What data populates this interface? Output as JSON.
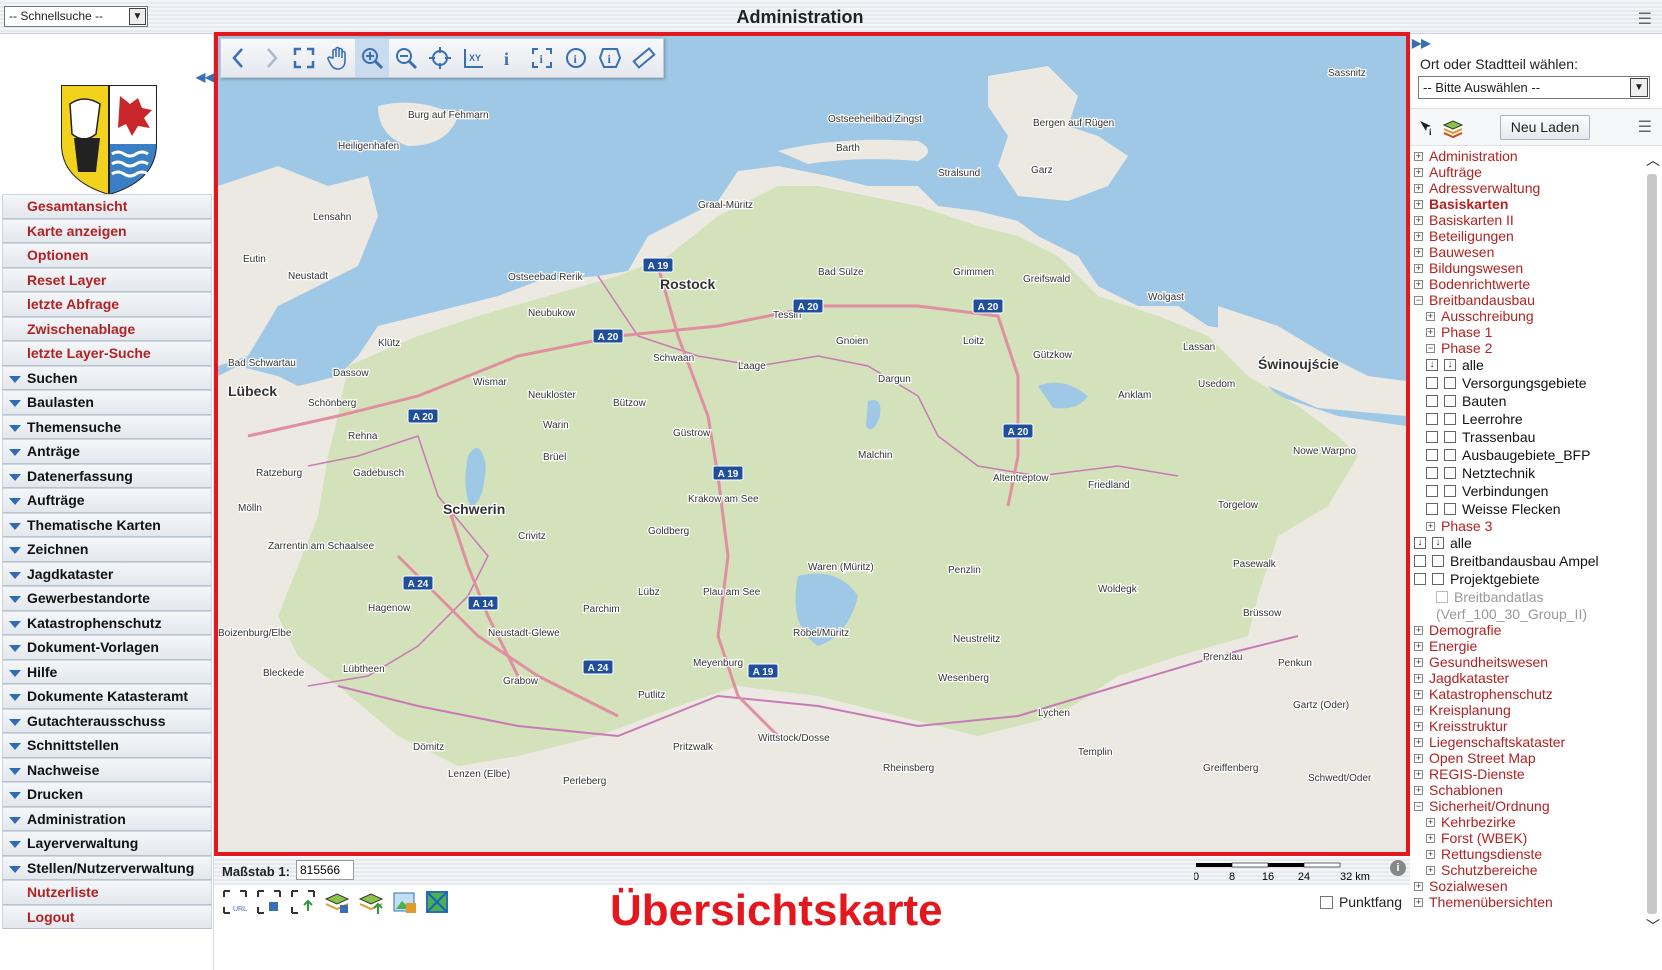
{
  "header": {
    "title": "Administration",
    "quicksearch": "-- Schnellsuche --",
    "menu_icon": "hamburger-icon"
  },
  "left_nav": {
    "items": [
      {
        "label": "Gesamtansicht",
        "style": "red"
      },
      {
        "label": "Karte anzeigen",
        "style": "red"
      },
      {
        "label": "Optionen",
        "style": "red"
      },
      {
        "label": "Reset Layer",
        "style": "red"
      },
      {
        "label": "letzte Abfrage",
        "style": "red"
      },
      {
        "label": "Zwischenablage",
        "style": "red"
      },
      {
        "label": "letzte Layer-Suche",
        "style": "red"
      },
      {
        "label": "Suchen",
        "style": "group"
      },
      {
        "label": "Baulasten",
        "style": "group"
      },
      {
        "label": "Themensuche",
        "style": "group"
      },
      {
        "label": "Anträge",
        "style": "group"
      },
      {
        "label": "Datenerfassung",
        "style": "group"
      },
      {
        "label": "Aufträge",
        "style": "group"
      },
      {
        "label": "Thematische Karten",
        "style": "group"
      },
      {
        "label": "Zeichnen",
        "style": "group"
      },
      {
        "label": "Jagdkataster",
        "style": "group"
      },
      {
        "label": "Gewerbestandorte",
        "style": "group"
      },
      {
        "label": "Katastrophenschutz",
        "style": "group"
      },
      {
        "label": "Dokument-Vorlagen",
        "style": "group"
      },
      {
        "label": "Hilfe",
        "style": "group"
      },
      {
        "label": "Dokumente Katasteramt",
        "style": "group"
      },
      {
        "label": "Gutachterausschuss",
        "style": "group"
      },
      {
        "label": "Schnittstellen",
        "style": "group"
      },
      {
        "label": "Nachweise",
        "style": "group"
      },
      {
        "label": "Drucken",
        "style": "group"
      },
      {
        "label": "Administration",
        "style": "group"
      },
      {
        "label": "Layerverwaltung",
        "style": "group"
      },
      {
        "label": "Stellen/Nutzerverwaltung",
        "style": "group"
      },
      {
        "label": "Nutzerliste",
        "style": "red"
      },
      {
        "label": "Logout",
        "style": "red"
      }
    ]
  },
  "map": {
    "places": [
      {
        "name": "Sassnitz"
      },
      {
        "name": "Burg auf Fehmarn"
      },
      {
        "name": "Ostseeheilbad Zingst"
      },
      {
        "name": "Bergen auf Rügen"
      },
      {
        "name": "Heiligenhafen"
      },
      {
        "name": "Barth"
      },
      {
        "name": "Garz"
      },
      {
        "name": "Stralsund"
      },
      {
        "name": "Graal-Müritz"
      },
      {
        "name": "Lensahn"
      },
      {
        "name": "Eutin"
      },
      {
        "name": "Neustadt"
      },
      {
        "name": "Ostseebad Rerik"
      },
      {
        "name": "Rostock"
      },
      {
        "name": "Bad Sülze"
      },
      {
        "name": "Grimmen"
      },
      {
        "name": "Greifswald"
      },
      {
        "name": "Wolgast"
      },
      {
        "name": "Neubukow"
      },
      {
        "name": "Tessin"
      },
      {
        "name": "Klütz"
      },
      {
        "name": "Gnoien"
      },
      {
        "name": "Loitz"
      },
      {
        "name": "Lassan"
      },
      {
        "name": "Świnoujście"
      },
      {
        "name": "Bad Schwartau"
      },
      {
        "name": "Dassow"
      },
      {
        "name": "Schwaan"
      },
      {
        "name": "Laage"
      },
      {
        "name": "Gützkow"
      },
      {
        "name": "Lübeck"
      },
      {
        "name": "Wismar"
      },
      {
        "name": "Dargun"
      },
      {
        "name": "Usedom"
      },
      {
        "name": "Schönberg"
      },
      {
        "name": "Neukloster"
      },
      {
        "name": "Bützow"
      },
      {
        "name": "Anklam"
      },
      {
        "name": "Rehna"
      },
      {
        "name": "Warin"
      },
      {
        "name": "Güstrow"
      },
      {
        "name": "Nowe Warpno"
      },
      {
        "name": "Ratzeburg"
      },
      {
        "name": "Brüel"
      },
      {
        "name": "Malchin"
      },
      {
        "name": "Gadebusch"
      },
      {
        "name": "Altentreptow"
      },
      {
        "name": "Friedland"
      },
      {
        "name": "Mölln"
      },
      {
        "name": "Schwerin"
      },
      {
        "name": "Krakow am See"
      },
      {
        "name": "Torgelow"
      },
      {
        "name": "Goldberg"
      },
      {
        "name": "Zarrentin am Schaalsee"
      },
      {
        "name": "Crivitz"
      },
      {
        "name": "Waren (Müritz)"
      },
      {
        "name": "Penzlin"
      },
      {
        "name": "Pasewalk"
      },
      {
        "name": "Hagenow"
      },
      {
        "name": "Lübz"
      },
      {
        "name": "Plau am See"
      },
      {
        "name": "Woldegk"
      },
      {
        "name": "Parchim"
      },
      {
        "name": "Brüssow"
      },
      {
        "name": "Boizenburg/Elbe"
      },
      {
        "name": "Neustadt-Glewe"
      },
      {
        "name": "Röbel/Müritz"
      },
      {
        "name": "Neustrelitz"
      },
      {
        "name": "Lübtheen"
      },
      {
        "name": "Prenzlau"
      },
      {
        "name": "Bleckede"
      },
      {
        "name": "Meyenburg"
      },
      {
        "name": "Penkun"
      },
      {
        "name": "Grabow"
      },
      {
        "name": "Wesenberg"
      },
      {
        "name": "Putlitz"
      },
      {
        "name": "Gartz (Oder)"
      },
      {
        "name": "Lychen"
      },
      {
        "name": "Dömitz"
      },
      {
        "name": "Pritzwalk"
      },
      {
        "name": "Wittstock/Dosse"
      },
      {
        "name": "Templin"
      },
      {
        "name": "Lenzen (Elbe)"
      },
      {
        "name": "Rheinsberg"
      },
      {
        "name": "Greiffenberg"
      },
      {
        "name": "Perleberg"
      },
      {
        "name": "Schwedt/Oder"
      }
    ],
    "roads": [
      "A 19",
      "A 20",
      "A 20",
      "A 20",
      "A 20",
      "A 20",
      "A 19",
      "A 24",
      "A 14",
      "A 24",
      "A 19"
    ]
  },
  "map_tools": [
    {
      "name": "back-icon",
      "glyph": "‹"
    },
    {
      "name": "forward-icon",
      "glyph": "›"
    },
    {
      "name": "full-extent-icon",
      "glyph": "⛶"
    },
    {
      "name": "pan-hand-icon",
      "glyph": "✋"
    },
    {
      "name": "zoom-in-icon",
      "glyph": "+"
    },
    {
      "name": "zoom-out-icon",
      "glyph": "−"
    },
    {
      "name": "recenter-icon",
      "glyph": "⊕"
    },
    {
      "name": "coordinates-icon",
      "glyph": "XY"
    },
    {
      "name": "info-icon",
      "glyph": "i"
    },
    {
      "name": "info-area-icon",
      "glyph": "[i]"
    },
    {
      "name": "info-circle-icon",
      "glyph": "ⓘ"
    },
    {
      "name": "info-polygon-icon",
      "glyph": "ⓘ"
    },
    {
      "name": "measure-ruler-icon",
      "glyph": "📏"
    }
  ],
  "status": {
    "scale_label": "Maßstab 1:",
    "scale_value": "815566",
    "scalebar_ticks": [
      "0",
      "8",
      "16",
      "24",
      "32 km"
    ],
    "overview_label": "Übersichtskarte",
    "punktfang": "Punktfang"
  },
  "right_panel": {
    "ort_label": "Ort oder Stadtteil wählen:",
    "ort_select": "-- Bitte Auswählen --",
    "neu_laden": "Neu Laden",
    "tree": [
      {
        "label": "Administration",
        "pm": "+",
        "lvl": 0,
        "cls": "red"
      },
      {
        "label": "Aufträge",
        "pm": "+",
        "lvl": 0,
        "cls": "red"
      },
      {
        "label": "Adressverwaltung",
        "pm": "+",
        "lvl": 0,
        "cls": "red"
      },
      {
        "label": "Basiskarten",
        "pm": "+",
        "lvl": 0,
        "cls": "red bold"
      },
      {
        "label": "Basiskarten II",
        "pm": "+",
        "lvl": 0,
        "cls": "red"
      },
      {
        "label": "Beteiligungen",
        "pm": "+",
        "lvl": 0,
        "cls": "red"
      },
      {
        "label": "Bauwesen",
        "pm": "+",
        "lvl": 0,
        "cls": "red"
      },
      {
        "label": "Bildungswesen",
        "pm": "+",
        "lvl": 0,
        "cls": "red"
      },
      {
        "label": "Bodenrichtwerte",
        "pm": "+",
        "lvl": 0,
        "cls": "red"
      },
      {
        "label": "Breitbandausbau",
        "pm": "−",
        "lvl": 0,
        "cls": "red"
      },
      {
        "label": "Ausschreibung",
        "pm": "+",
        "lvl": 1,
        "cls": "red"
      },
      {
        "label": "Phase 1",
        "pm": "+",
        "lvl": 1,
        "cls": "red"
      },
      {
        "label": "Phase 2",
        "pm": "−",
        "lvl": 1,
        "cls": "red"
      },
      {
        "label": "alle",
        "pm": "cbarrow",
        "lvl": 1,
        "cls": "dark",
        "arrow": true
      },
      {
        "label": "Versorgungsgebiete",
        "pm": "cb",
        "lvl": 1,
        "cls": "dark",
        "box2": true
      },
      {
        "label": "Bauten",
        "pm": "cb",
        "lvl": 1,
        "cls": "dark",
        "box2": true
      },
      {
        "label": "Leerrohre",
        "pm": "cb",
        "lvl": 1,
        "cls": "dark",
        "box2": true
      },
      {
        "label": "Trassenbau",
        "pm": "cb",
        "lvl": 1,
        "cls": "dark",
        "box2": true
      },
      {
        "label": "Ausbaugebiete_BFP",
        "pm": "cb",
        "lvl": 1,
        "cls": "dark",
        "box2": true
      },
      {
        "label": "Netztechnik",
        "pm": "cb",
        "lvl": 1,
        "cls": "dark",
        "box2": true
      },
      {
        "label": "Verbindungen",
        "pm": "cb",
        "lvl": 1,
        "cls": "dark",
        "box2": true
      },
      {
        "label": "Weisse Flecken",
        "pm": "cb",
        "lvl": 1,
        "cls": "dark",
        "box2": true
      },
      {
        "label": "Phase 3",
        "pm": "+",
        "lvl": 1,
        "cls": "red"
      },
      {
        "label": "alle",
        "pm": "cbarrow",
        "lvl": 0,
        "cls": "dark",
        "arrow": true
      },
      {
        "label": "Breitbandausbau Ampel",
        "pm": "cb",
        "lvl": 0,
        "cls": "dark",
        "box2": true
      },
      {
        "label": "Projektgebiete",
        "pm": "cb",
        "lvl": 0,
        "cls": "dark",
        "box2": true
      },
      {
        "label": "Breitbandatlas",
        "pm": "none",
        "lvl": 0,
        "cls": "grey",
        "greybox": true
      },
      {
        "label": "(Verf_100_30_Group_II)",
        "pm": "none",
        "lvl": 0,
        "cls": "grey",
        "indent_extra": true
      },
      {
        "label": "Demografie",
        "pm": "+",
        "lvl": 0,
        "cls": "red"
      },
      {
        "label": "Energie",
        "pm": "+",
        "lvl": 0,
        "cls": "red"
      },
      {
        "label": "Gesundheitswesen",
        "pm": "+",
        "lvl": 0,
        "cls": "red"
      },
      {
        "label": "Jagdkataster",
        "pm": "+",
        "lvl": 0,
        "cls": "red"
      },
      {
        "label": "Katastrophenschutz",
        "pm": "+",
        "lvl": 0,
        "cls": "red"
      },
      {
        "label": "Kreisplanung",
        "pm": "+",
        "lvl": 0,
        "cls": "red"
      },
      {
        "label": "Kreisstruktur",
        "pm": "+",
        "lvl": 0,
        "cls": "red"
      },
      {
        "label": "Liegenschaftskataster",
        "pm": "+",
        "lvl": 0,
        "cls": "red"
      },
      {
        "label": "Open Street Map",
        "pm": "+",
        "lvl": 0,
        "cls": "red"
      },
      {
        "label": "REGIS-Dienste",
        "pm": "+",
        "lvl": 0,
        "cls": "red"
      },
      {
        "label": "Schablonen",
        "pm": "+",
        "lvl": 0,
        "cls": "red"
      },
      {
        "label": "Sicherheit/Ordnung",
        "pm": "−",
        "lvl": 0,
        "cls": "red"
      },
      {
        "label": "Kehrbezirke",
        "pm": "+",
        "lvl": 1,
        "cls": "red"
      },
      {
        "label": "Forst (WBEK)",
        "pm": "+",
        "lvl": 1,
        "cls": "red"
      },
      {
        "label": "Rettungsdienste",
        "pm": "+",
        "lvl": 1,
        "cls": "red"
      },
      {
        "label": "Schutzbereiche",
        "pm": "+",
        "lvl": 1,
        "cls": "red"
      },
      {
        "label": "Sozialwesen",
        "pm": "+",
        "lvl": 0,
        "cls": "red"
      },
      {
        "label": "Themenübersichten",
        "pm": "+",
        "lvl": 0,
        "cls": "red"
      }
    ]
  },
  "colors": {
    "accent_red": "#e4171e",
    "link_red": "#b22222",
    "nav_blue": "#2e6db4",
    "water": "#9ec8e6",
    "land": "#eceae3"
  }
}
